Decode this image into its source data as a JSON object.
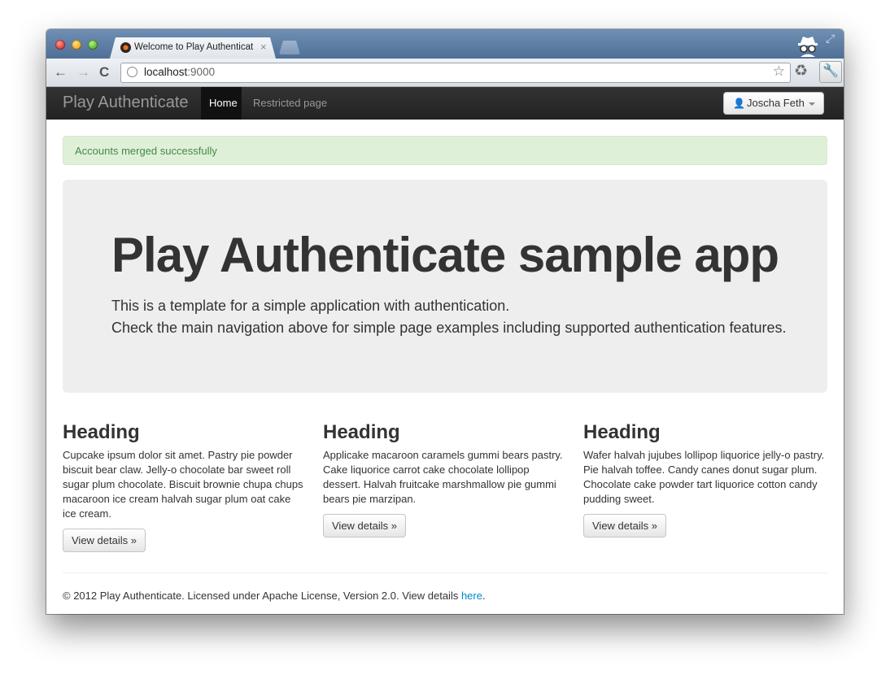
{
  "browser": {
    "tab_title": "Welcome to Play Authenticat",
    "tab_close": "×",
    "url_host": "localhost",
    "url_port": ":9000",
    "back": "←",
    "forward": "→",
    "reload": "C",
    "star": "☆",
    "extension": "♻",
    "wrench": "🔧",
    "expand": "⤢"
  },
  "navbar": {
    "brand": "Play Authenticate",
    "items": [
      {
        "label": "Home",
        "active": true
      },
      {
        "label": "Restricted page",
        "active": false
      }
    ],
    "user_icon": "👤",
    "user_name": "Joscha Feth"
  },
  "alert": {
    "text": "Accounts merged successfully",
    "color": "#468847"
  },
  "hero": {
    "title": "Play Authenticate sample app",
    "line1": "This is a template for a simple application with authentication.",
    "line2": "Check the main navigation above for simple page examples including supported authentication features."
  },
  "columns": [
    {
      "heading": "Heading",
      "text": "Cupcake ipsum dolor sit amet. Pastry pie powder biscuit bear claw. Jelly-o chocolate bar sweet roll sugar plum chocolate. Biscuit brownie chupa chups macaroon ice cream halvah sugar plum oat cake ice cream.",
      "button": "View details »"
    },
    {
      "heading": "Heading",
      "text": "Applicake macaroon caramels gummi bears pastry. Cake liquorice carrot cake chocolate lollipop dessert. Halvah fruitcake marshmallow pie gummi bears pie marzipan.",
      "button": "View details »"
    },
    {
      "heading": "Heading",
      "text": "Wafer halvah jujubes lollipop liquorice jelly-o pastry. Pie halvah toffee. Candy canes donut sugar plum. Chocolate cake powder tart liquorice cotton candy pudding sweet.",
      "button": "View details »"
    }
  ],
  "footer": {
    "text": "© 2012 Play Authenticate. Licensed under Apache License, Version 2.0. View details ",
    "link": "here",
    "period": ".",
    "link_color": "#0088cc"
  }
}
